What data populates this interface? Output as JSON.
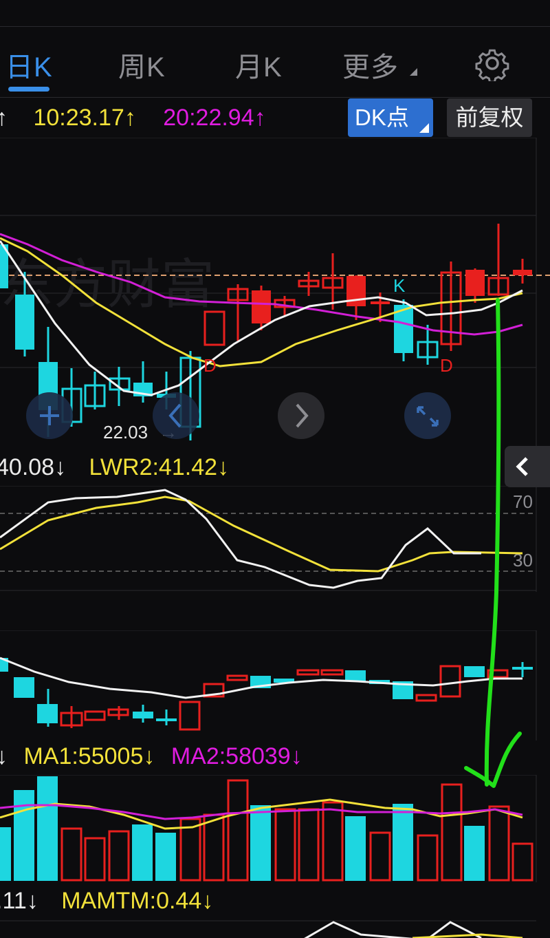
{
  "tabs": [
    {
      "label": "日K",
      "active": true
    },
    {
      "label": "周K",
      "active": false
    },
    {
      "label": "月K",
      "active": false
    },
    {
      "label": "更多",
      "active": false
    }
  ],
  "ma_row": {
    "arrow_left": "↑",
    "ma10": "10:23.17",
    "ma10_arrow": "↑",
    "ma20": "20:22.94",
    "ma20_arrow": "↑"
  },
  "buttons": {
    "dk": "DK点",
    "fuquan": "前复权"
  },
  "kline": {
    "low_label": "22.03",
    "low_arrow": "→",
    "k_marker": "K",
    "d_marker": "D"
  },
  "lwr_row": {
    "lwr1": "40.08",
    "lwr1_arrow": "↓",
    "lwr2": "LWR2:41.42",
    "lwr2_arrow": "↓"
  },
  "lwr_axis": {
    "high": "70",
    "low": "30"
  },
  "vol_row": {
    "arrow_left": "↓",
    "ma1": "MA1:55005",
    "ma1_arrow": "↓",
    "ma2": "MA2:58039",
    "ma2_arrow": "↓"
  },
  "mtm_row": {
    "mtm": ".11",
    "mtm_arrow": "↓",
    "mamtm": "MAMTM:0.44",
    "mamtm_arrow": "↓"
  },
  "colors": {
    "up": "#e8201e",
    "down": "#1ed6e0",
    "ma_white": "#f2f2f2",
    "ma_yellow": "#f2e13a",
    "ma_magenta": "#d21fd6",
    "accent": "#3a8fe8",
    "annotation": "#22e01a"
  }
}
